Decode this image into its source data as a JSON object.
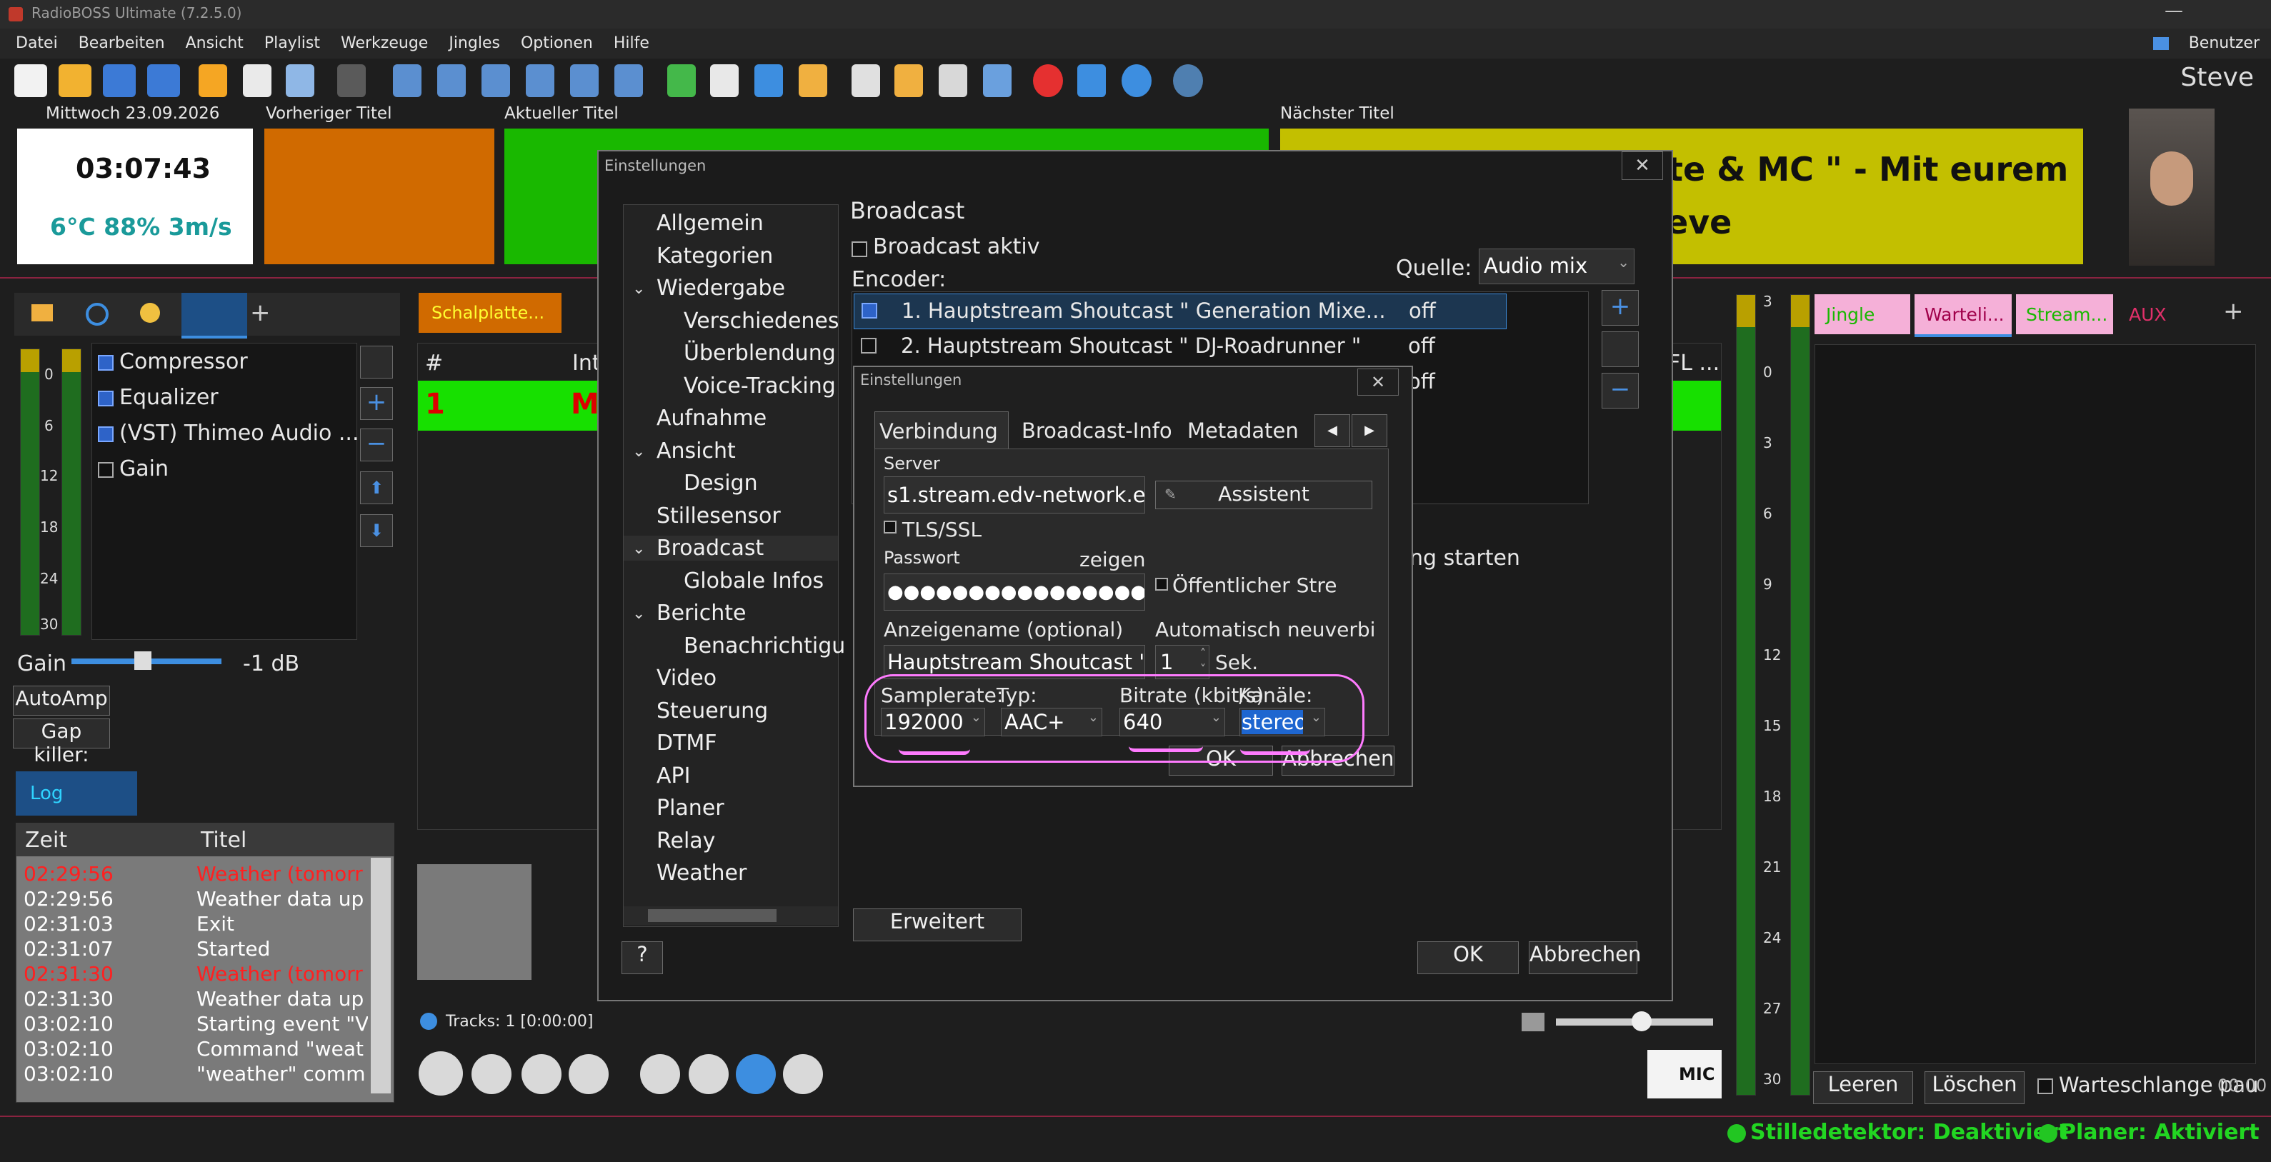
{
  "window": {
    "title": "RadioBOSS Ultimate (7.2.5.0)",
    "user_button": "Benutzer",
    "user_name": "Steve"
  },
  "menu": [
    "Datei",
    "Bearbeiten",
    "Ansicht",
    "Playlist",
    "Werkzeuge",
    "Jingles",
    "Optionen",
    "Hilfe"
  ],
  "info": {
    "date": "Mittwoch 23.09.2026",
    "time": "03:07:43",
    "weather": "6°C 88% 3m/s",
    "prev_label": "Vorheriger Titel",
    "current_label": "Aktueller Titel",
    "next_label": "Nächster Titel",
    "next_text_line1": "tte & MC \" - Mit eurem",
    "next_text_line2": "eve"
  },
  "effects": {
    "items": [
      {
        "label": "Compressor",
        "checked": true
      },
      {
        "label": "Equalizer",
        "checked": true
      },
      {
        "label": "(VST) Thimeo Audio ...",
        "checked": true
      },
      {
        "label": "Gain",
        "checked": false
      }
    ],
    "gain_label": "Gain",
    "gain_value": "-1 dB",
    "autoamp": "AutoAmp",
    "gapkiller": "Gap killer:",
    "scale": [
      "0",
      "6",
      "12",
      "18",
      "24",
      "30"
    ]
  },
  "log": {
    "tab": "Log",
    "col_time": "Zeit",
    "col_title": "Titel",
    "rows": [
      {
        "time": "02:29:56",
        "title": "Weather (tomorr",
        "red": true
      },
      {
        "time": "02:29:56",
        "title": "Weather data up",
        "red": false
      },
      {
        "time": "02:31:03",
        "title": "Exit",
        "red": false
      },
      {
        "time": "02:31:07",
        "title": "Started",
        "red": false
      },
      {
        "time": "02:31:30",
        "title": "Weather (tomorr",
        "red": true
      },
      {
        "time": "02:31:30",
        "title": "Weather data up",
        "red": false
      },
      {
        "time": "03:02:10",
        "title": "Starting event \"V",
        "red": false
      },
      {
        "time": "03:02:10",
        "title": "Command \"weat",
        "red": false
      },
      {
        "time": "03:02:10",
        "title": "\"weather\" comm",
        "red": false
      }
    ]
  },
  "playlist": {
    "tab": "Schalplatte...",
    "col_num": "#",
    "col_title": "Int",
    "row1_num": "1",
    "row1_title": "M",
    "tracks": "Tracks: 1 [0:00:00]",
    "mic": "MIC",
    "col_right": "FL ..."
  },
  "rightpanel": {
    "tabs": [
      "Jingle",
      "Warteli...",
      "Stream...",
      "AUX"
    ],
    "btn_clear": "Leeren",
    "btn_delete": "Löschen",
    "queue_pause": "Warteschlange pau",
    "time": "00:00",
    "scale": [
      "3",
      "0",
      "3",
      "6",
      "9",
      "12",
      "15",
      "18",
      "21",
      "24",
      "27",
      "30"
    ]
  },
  "status": {
    "silence": "Stilledetektor: Deaktiviert",
    "planner": "Planer: Aktiviert"
  },
  "settings": {
    "title": "Einstellungen",
    "tree": [
      {
        "label": "Allgemein",
        "level": 0,
        "chev": ""
      },
      {
        "label": "Kategorien",
        "level": 0,
        "chev": ""
      },
      {
        "label": "Wiedergabe",
        "level": 0,
        "chev": "v"
      },
      {
        "label": "Verschiedenes",
        "level": 1,
        "chev": ""
      },
      {
        "label": "Überblendung",
        "level": 1,
        "chev": ""
      },
      {
        "label": "Voice-Tracking",
        "level": 1,
        "chev": ""
      },
      {
        "label": "Aufnahme",
        "level": 0,
        "chev": ""
      },
      {
        "label": "Ansicht",
        "level": 0,
        "chev": "v"
      },
      {
        "label": "Design",
        "level": 1,
        "chev": ""
      },
      {
        "label": "Stillesensor",
        "level": 0,
        "chev": ""
      },
      {
        "label": "Broadcast",
        "level": 0,
        "chev": "v"
      },
      {
        "label": "Globale Infos",
        "level": 1,
        "chev": ""
      },
      {
        "label": "Berichte",
        "level": 0,
        "chev": "v"
      },
      {
        "label": "Benachrichtigu",
        "level": 1,
        "chev": ""
      },
      {
        "label": "Video",
        "level": 0,
        "chev": ""
      },
      {
        "label": "Steuerung",
        "level": 0,
        "chev": ""
      },
      {
        "label": "DTMF",
        "level": 0,
        "chev": ""
      },
      {
        "label": "API",
        "level": 0,
        "chev": ""
      },
      {
        "label": "Planer",
        "level": 0,
        "chev": ""
      },
      {
        "label": "Relay",
        "level": 0,
        "chev": ""
      },
      {
        "label": "Weather",
        "level": 0,
        "chev": ""
      }
    ],
    "broadcast_heading": "Broadcast",
    "broadcast_active": "Broadcast aktiv",
    "encoder_label": "Encoder:",
    "source_label": "Quelle:",
    "source_value": "Audio mix",
    "encoders": [
      {
        "name": "1. Hauptstream Shoutcast \" Generation Mixe...",
        "state": "off",
        "checked": true
      },
      {
        "name": "2. Hauptstream Shoutcast \" DJ-Roadrunner \"",
        "state": "off",
        "checked": false
      },
      {
        "name": "",
        "state": "off",
        "checked": false
      }
    ],
    "start_text": "ung starten",
    "advanced": "Erweitert",
    "help": "?",
    "ok": "OK",
    "cancel": "Abbrechen"
  },
  "encoder_dialog": {
    "title": "Einstellungen",
    "tabs": [
      "Verbindung",
      "Broadcast-Info",
      "Metadaten"
    ],
    "server_label": "Server",
    "server_value": "s1.stream.edv-network.eu",
    "assistant": "Assistent",
    "tls": "TLS/SSL",
    "password_label": "Passwort",
    "password_value": "●●●●●●●●●●●●●●●●●●",
    "show_pw": "zeigen",
    "public": "Öffentlicher Stre",
    "display_name_label": "Anzeigename (optional)",
    "display_name_value": "Hauptstream Shoutcast \"",
    "reconnect_label": "Automatisch neuverbi",
    "reconnect_value": "1",
    "reconnect_unit": "Sek.",
    "samplerate_label": "Samplerate:",
    "samplerate_value": "192000",
    "type_label": "Typ:",
    "type_value": "AAC+",
    "bitrate_label": "Bitrate (kbit/s)",
    "bitrate_value": "640",
    "channels_label": "Kanäle:",
    "channels_value": "stereo",
    "ok": "OK",
    "cancel": "Abbrechen"
  },
  "colors": {
    "prev": "#d06a00",
    "current": "#19b800",
    "next": "#c3bf00",
    "accent_pink": "#ff7bff",
    "log_red": "#ff2020",
    "green_row": "#17e000"
  }
}
